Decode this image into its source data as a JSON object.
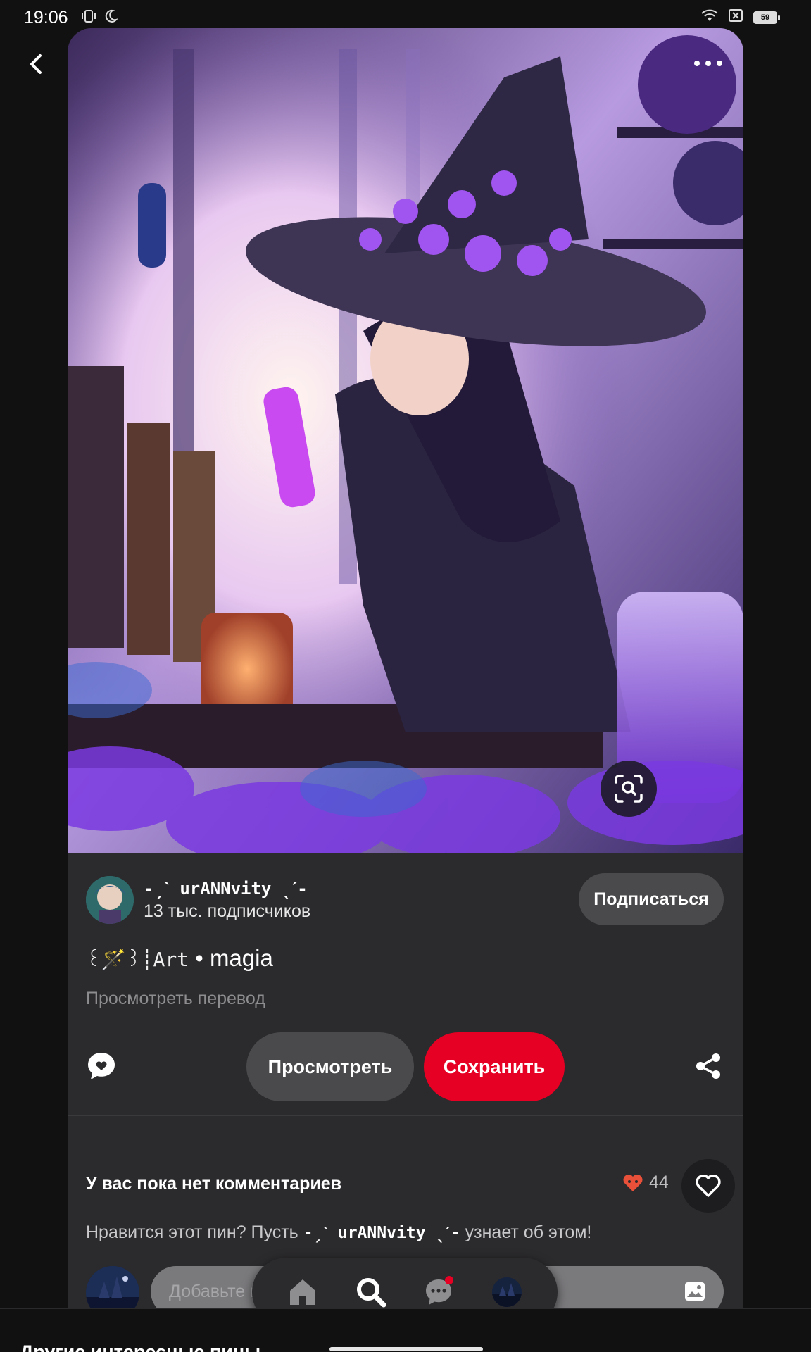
{
  "status_bar": {
    "time": "19:06",
    "battery": "59",
    "icons": [
      "vibrate-icon",
      "moon-icon",
      "wifi-icon",
      "no-sim-icon",
      "battery-icon"
    ]
  },
  "pin": {
    "title_decoration": "꒰🪄꒱┊Art",
    "title_separator": "•",
    "title": "magia",
    "translate_link": "Просмотреть перевод"
  },
  "author": {
    "name": "-ˏˋ urANNvity ˎˊ-",
    "followers": "13 тыс. подписчиков",
    "follow_label": "Подписаться"
  },
  "actions": {
    "view_label": "Просмотреть",
    "save_label": "Сохранить"
  },
  "comments": {
    "empty_title": "У вас пока нет комментариев",
    "likes_count": "44",
    "prompt_prefix": "Нравится этот пин? Пусть",
    "prompt_user": "-ˏˋ urANNvity ˎˊ-",
    "prompt_suffix": "узнает об этом!",
    "input_placeholder": "Добавьте комментарий"
  },
  "bottom_nav": {
    "items": [
      "home-icon",
      "search-icon",
      "messages-icon",
      "profile-avatar"
    ],
    "active": "search-icon"
  },
  "sheet": {
    "title": "Другие интересные пины"
  },
  "colors": {
    "background": "#111112",
    "card": "#2b2a2c",
    "save_red": "#e60023",
    "like_heart": "#e8503a",
    "secondary_button": "#4a494b"
  }
}
